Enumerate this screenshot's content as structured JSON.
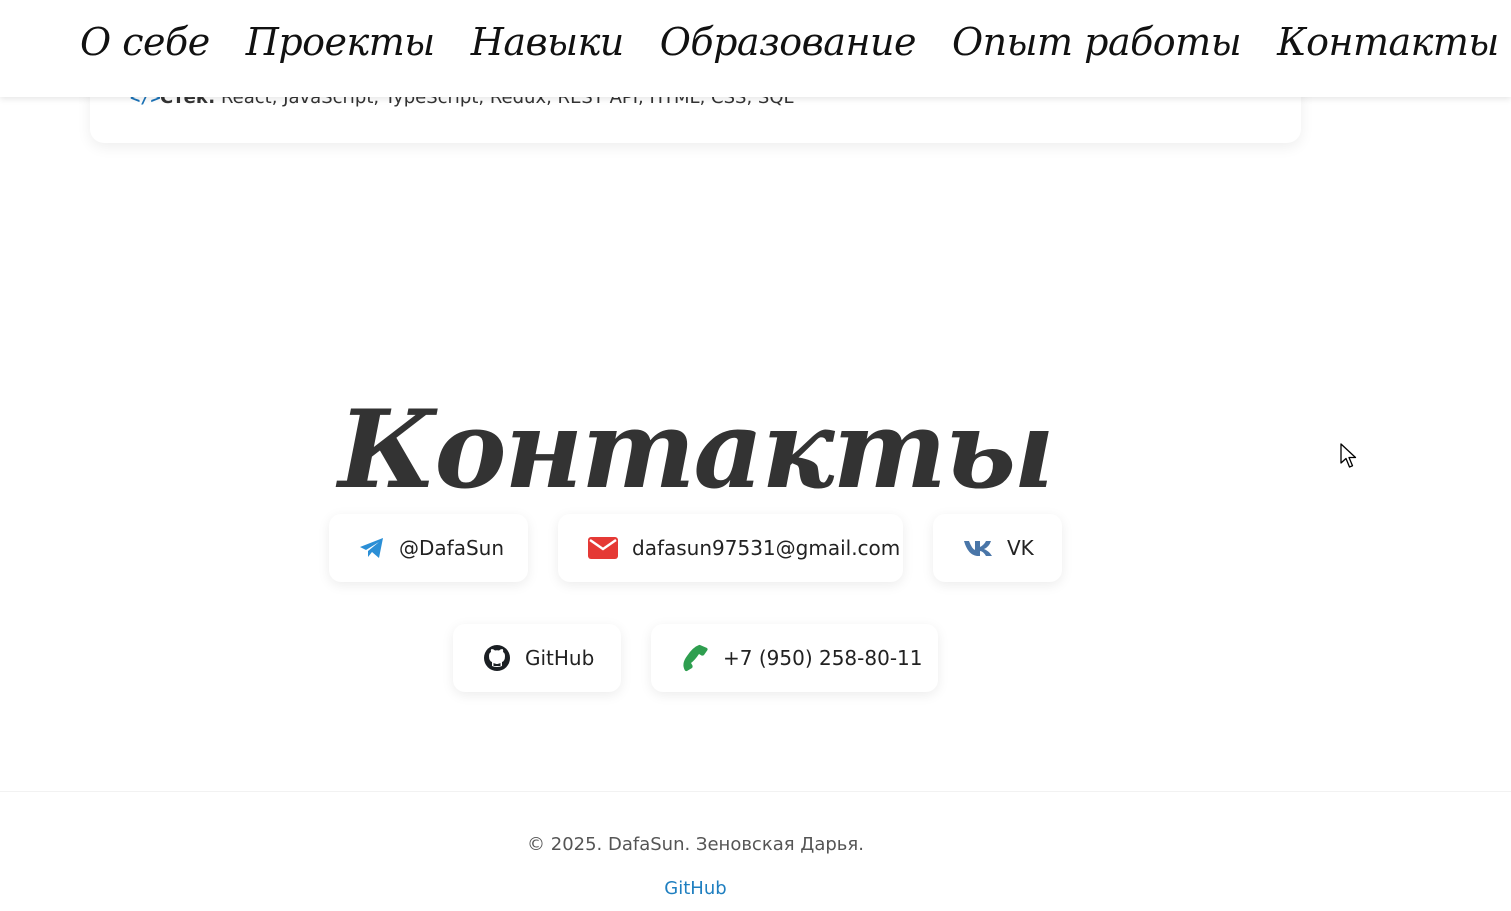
{
  "nav": {
    "items": [
      "О себе",
      "Проекты",
      "Навыки",
      "Образование",
      "Опыт работы",
      "Контакты"
    ]
  },
  "project": {
    "stack_label": "Стек:",
    "stack_value": " React, JavaScript, TypeScript, Redux, REST API, HTML, CSS, SQL",
    "icon": "code-icon"
  },
  "contacts": {
    "title": "Контакты",
    "telegram": {
      "label": "@DafaSun",
      "icon": "telegram-icon",
      "color": "#2b8fd6"
    },
    "email": {
      "label": "dafasun97531@gmail.com",
      "icon": "envelope-icon",
      "color": "#e53935"
    },
    "vk": {
      "label": "VK",
      "icon": "vk-icon",
      "color": "#4a76a8"
    },
    "github": {
      "label": "GitHub",
      "icon": "github-icon",
      "color": "#1b1f23"
    },
    "phone": {
      "label": "+7 (950) 258-80-11",
      "icon": "phone-icon",
      "color": "#2e9e4f"
    }
  },
  "footer": {
    "copyright": "© 2025. DafaSun. Зеновская Дарья.",
    "link": "GitHub",
    "link_color": "#1f7fc0"
  }
}
